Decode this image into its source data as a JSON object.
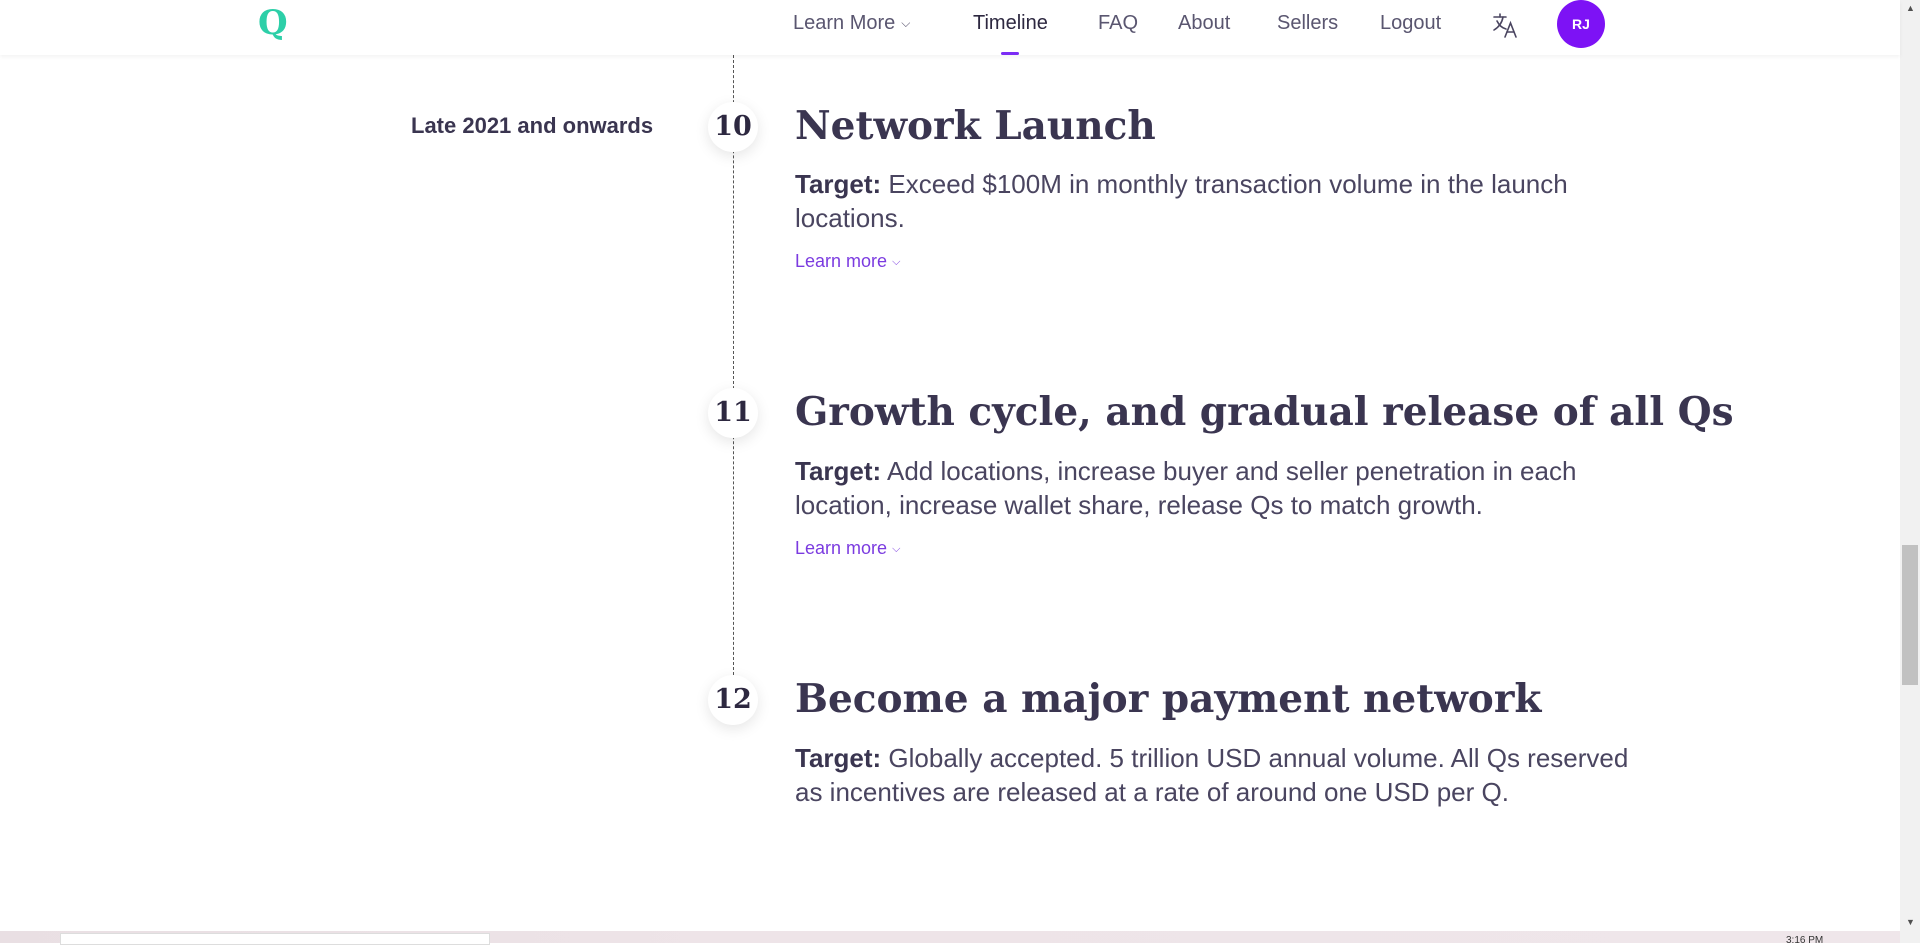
{
  "header": {
    "logo": "Q",
    "nav": [
      {
        "label": "Learn More",
        "dropdown": true
      },
      {
        "label": "Timeline",
        "active": true
      },
      {
        "label": "FAQ"
      },
      {
        "label": "About"
      },
      {
        "label": "Sellers"
      },
      {
        "label": "Logout"
      }
    ],
    "translate_icon": "translate-icon",
    "avatar": "RJ"
  },
  "timeline": {
    "phase_label": "Late 2021 and onwards",
    "steps": [
      {
        "number": "10",
        "title": "Network Launch",
        "target_label": "Target:",
        "target_text": " Exceed $100M in monthly transaction volume in the launch locations.",
        "learn_more": "Learn more"
      },
      {
        "number": "11",
        "title": "Growth cycle, and gradual release of all Qs",
        "target_label": "Target:",
        "target_text": " Add locations, increase buyer and seller penetration in each location, increase wallet share, release Qs to match growth.",
        "learn_more": "Learn more"
      },
      {
        "number": "12",
        "title": "Become a major payment network",
        "target_label": "Target:",
        "target_text": " Globally accepted. 5 trillion USD annual volume. All Qs reserved as incentives are released at a rate of around one USD per Q."
      }
    ]
  },
  "taskbar": {
    "clock": "3:16 PM"
  },
  "colors": {
    "accent": "#7b2cf5",
    "logo": "#2dcfa8",
    "avatar_bg": "#7d12f5",
    "link": "#7b3be0"
  }
}
